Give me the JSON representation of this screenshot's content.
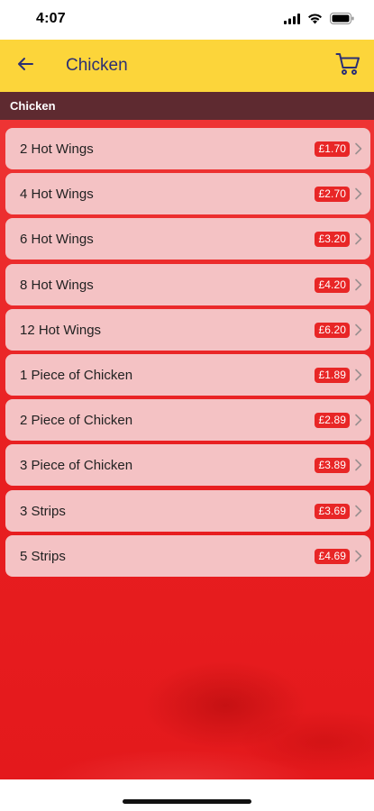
{
  "status_bar": {
    "time": "4:07"
  },
  "header": {
    "title": "Chicken"
  },
  "section": {
    "title": "Chicken"
  },
  "items": [
    {
      "name": "2 Hot Wings",
      "price": "£1.70"
    },
    {
      "name": "4 Hot Wings",
      "price": "£2.70"
    },
    {
      "name": "6 Hot Wings",
      "price": "£3.20"
    },
    {
      "name": "8 Hot Wings",
      "price": "£4.20"
    },
    {
      "name": "12 Hot Wings",
      "price": "£6.20"
    },
    {
      "name": "1 Piece of Chicken",
      "price": "£1.89"
    },
    {
      "name": "2 Piece of Chicken",
      "price": "£2.89"
    },
    {
      "name": "3 Piece of Chicken",
      "price": "£3.89"
    },
    {
      "name": "3 Strips",
      "price": "£3.69"
    },
    {
      "name": "5 Strips",
      "price": "£4.69"
    }
  ],
  "colors": {
    "header_bg": "#fcd53a",
    "title_color": "#2b2f73",
    "section_bg": "#5e2a30",
    "item_bg": "#f4c2c4",
    "price_badge": "#e82626",
    "background": "#e81e20"
  },
  "icons": {
    "back": "back-arrow-icon",
    "cart": "cart-icon",
    "chevron": "chevron-right-icon"
  }
}
